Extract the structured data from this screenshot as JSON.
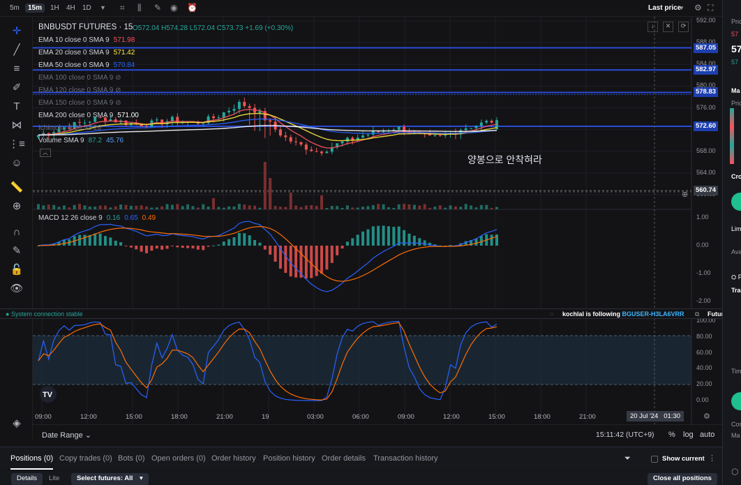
{
  "toolbar": {
    "timeframes": [
      "5m",
      "15m",
      "1H",
      "4H",
      "1D"
    ],
    "active_timeframe": "15m",
    "last_price_label": "Last price"
  },
  "legend": {
    "symbol": "BNBUSDT FUTURES · 15",
    "ohlc": "O572.04 H574.28 L572.04 C573.73 +1.69 (+0.30%)",
    "ema10": {
      "label": "EMA 10 close 0 SMA 9",
      "value": "571.98",
      "color": "#f7525f"
    },
    "ema20": {
      "label": "EMA 20 close 0 SMA 9",
      "value": "571.42",
      "color": "#ffeb3b"
    },
    "ema50": {
      "label": "EMA 50 close 0 SMA 9",
      "value": "570.84",
      "color": "#2962ff"
    },
    "ema100": {
      "label": "EMA 100 close 0 SMA 9"
    },
    "ema120": {
      "label": "EMA 120 close 0 SMA 9"
    },
    "ema150": {
      "label": "EMA 150 close 0 SMA 9"
    },
    "ema200": {
      "label": "EMA 200 close 0 SMA 9",
      "value": "571.00",
      "color": "#ffffff"
    },
    "ichimoku": {
      "label": "Ichimoku 9 26 52 26"
    },
    "volume": {
      "label": "Volume SMA 9",
      "v1": "87.2",
      "v2": "45.76"
    },
    "macd": {
      "label": "MACD 12 26 close 9",
      "v1": "0.16",
      "v2": "0.65",
      "v3": "0.49"
    }
  },
  "annotation_text": "양봉으로 안착혀라",
  "price_axis": {
    "ticks": [
      "592.00",
      "588.00",
      "584.00",
      "580.00",
      "576.00",
      "572.00",
      "568.00",
      "564.00",
      "560.00"
    ],
    "tags": [
      {
        "value": "587.05",
        "color": "#1e3fae"
      },
      {
        "value": "582.97",
        "color": "#1e3fae"
      },
      {
        "value": "578.83",
        "color": "#1e3fae"
      },
      {
        "value": "572.60",
        "color": "#1e3fae"
      },
      {
        "value": "560.74",
        "color": "#363a45"
      }
    ],
    "macd_ticks": [
      "1.00",
      "0.00",
      "-1.00",
      "-2.00"
    ],
    "stoch_ticks": [
      "100.00",
      "80.00",
      "60.00",
      "40.00",
      "20.00",
      "0.00"
    ]
  },
  "time_axis": {
    "labels": [
      "09:00",
      "12:00",
      "15:00",
      "18:00",
      "21:00",
      "19",
      "03:00",
      "06:00",
      "09:00",
      "12:00",
      "15:00",
      "18:00",
      "21:00"
    ],
    "crosshair_date": "20 Jul '24",
    "crosshair_time": "01:30"
  },
  "status": {
    "connection": "System connection stable",
    "following_user": "kochlal",
    "following_text": "is following",
    "following_target": "BGUSER-H3LA6VRR",
    "futures_copy": "Futures Copy"
  },
  "range": {
    "date_range_label": "Date Range",
    "clock": "15:11:42 (UTC+9)",
    "percent": "%",
    "log": "log",
    "auto": "auto"
  },
  "tabs": [
    "Positions (0)",
    "Copy trades (0)",
    "Bots (0)",
    "Open orders (0)",
    "Order history",
    "Position history",
    "Order details",
    "Transaction history"
  ],
  "show_current": "Show current",
  "subbar": {
    "details": "Details",
    "lite": "Lite",
    "select_futures": "Select futures: All",
    "close_all": "Close all positions"
  },
  "right_panel": {
    "items": [
      "Pric",
      "57",
      "Ma",
      "Pric",
      "Cro",
      "Lim",
      "Ava",
      "P",
      "Trac",
      "Tim",
      "Cos",
      "Ma"
    ]
  },
  "chart_data": {
    "type": "candlestick",
    "symbol": "BNBUSDT",
    "ylim": [
      558,
      593
    ],
    "last_ohlc": {
      "open": 572.04,
      "high": 574.28,
      "low": 572.04,
      "close": 573.73
    },
    "horizontal_levels": [
      587.05,
      582.97,
      578.83,
      572.6,
      560.74
    ],
    "close_path": [
      571,
      571.6,
      572.2,
      572.8,
      573.3,
      573.9,
      574.1,
      573.6,
      573.2,
      572.9,
      573.1,
      573.4,
      573.8,
      573.5,
      573.2,
      573.7,
      574.4,
      575.6,
      576.8,
      576.1,
      574.6,
      572.4,
      570.6,
      569.4,
      568.7,
      567.9,
      568.6,
      569.5,
      570.2,
      570.9,
      571.4,
      571.9,
      572.4,
      571.7,
      570.9,
      570.4,
      570.6,
      571.4,
      572.3,
      572.7,
      573.3,
      573.73
    ],
    "macd": {
      "macd": 0.65,
      "signal": 0.49,
      "hist": 0.16
    },
    "stoch_bands": [
      80,
      20
    ]
  }
}
